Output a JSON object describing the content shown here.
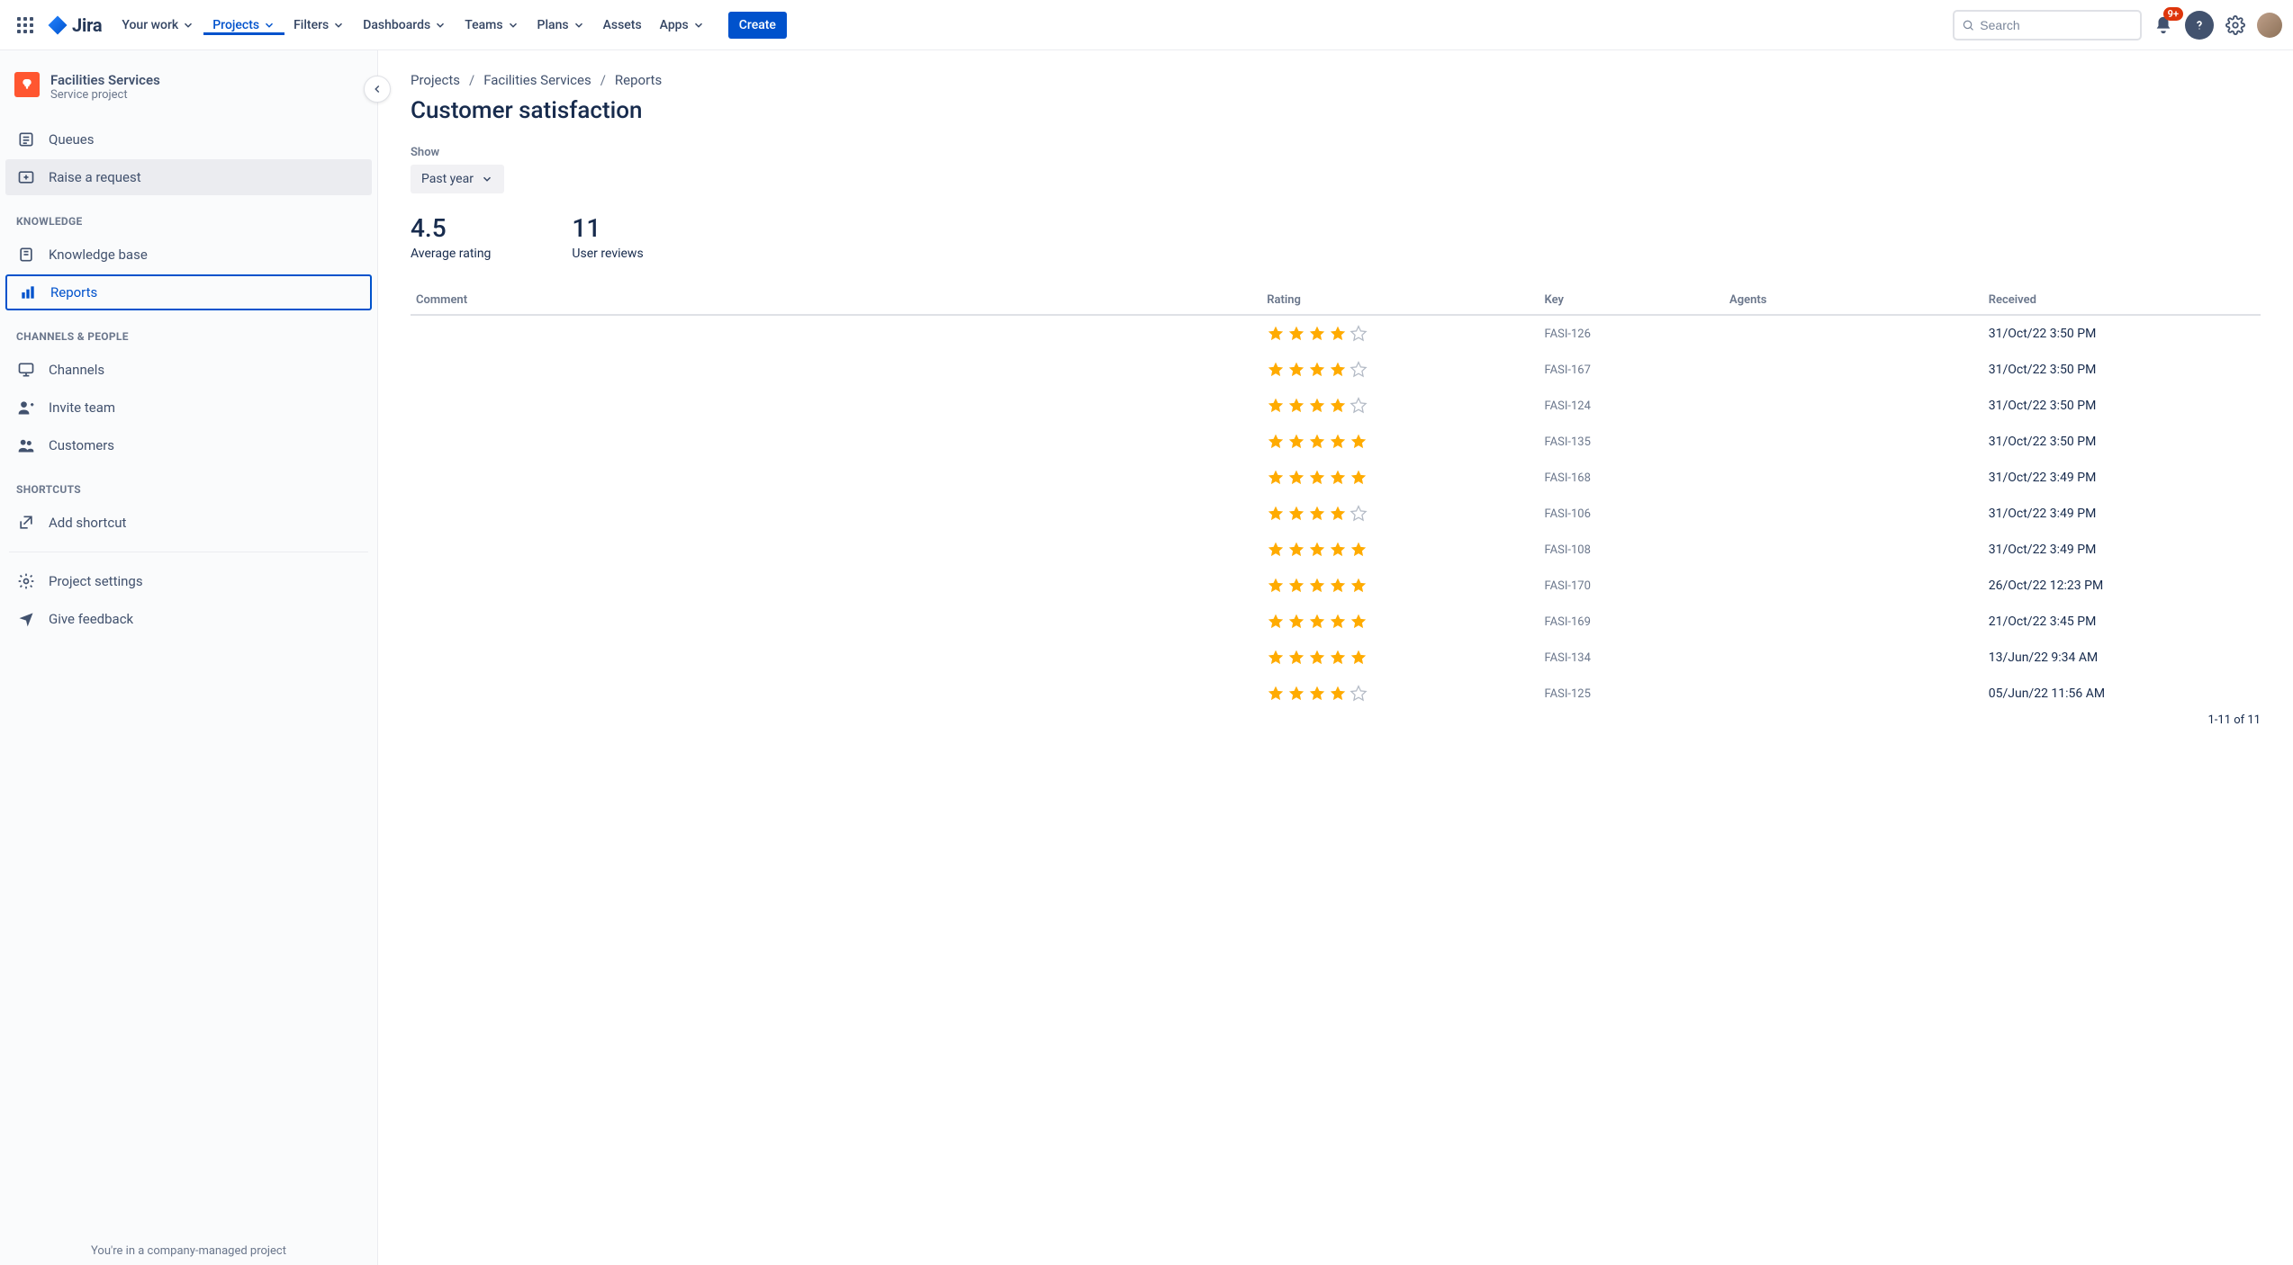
{
  "nav": {
    "logo_text": "Jira",
    "items": [
      {
        "label": "Your work",
        "dropdown": true
      },
      {
        "label": "Projects",
        "dropdown": true,
        "active": true
      },
      {
        "label": "Filters",
        "dropdown": true
      },
      {
        "label": "Dashboards",
        "dropdown": true
      },
      {
        "label": "Teams",
        "dropdown": true
      },
      {
        "label": "Plans",
        "dropdown": true
      },
      {
        "label": "Assets",
        "dropdown": false
      },
      {
        "label": "Apps",
        "dropdown": true
      }
    ],
    "create_label": "Create",
    "search_placeholder": "Search",
    "notification_badge": "9+"
  },
  "sidebar": {
    "project_name": "Facilities Services",
    "project_type": "Service project",
    "items_top": [
      {
        "label": "Queues",
        "icon": "queue-icon"
      },
      {
        "label": "Raise a request",
        "icon": "raise-request-icon",
        "selected": true
      }
    ],
    "section_knowledge": "KNOWLEDGE",
    "items_knowledge": [
      {
        "label": "Knowledge base",
        "icon": "book-icon"
      },
      {
        "label": "Reports",
        "icon": "reports-icon",
        "active": true
      }
    ],
    "section_channels": "CHANNELS & PEOPLE",
    "items_channels": [
      {
        "label": "Channels",
        "icon": "monitor-icon"
      },
      {
        "label": "Invite team",
        "icon": "invite-icon"
      },
      {
        "label": "Customers",
        "icon": "customers-icon"
      }
    ],
    "section_shortcuts": "SHORTCUTS",
    "items_shortcuts": [
      {
        "label": "Add shortcut",
        "icon": "add-shortcut-icon"
      }
    ],
    "items_footer": [
      {
        "label": "Project settings",
        "icon": "gear-icon"
      },
      {
        "label": "Give feedback",
        "icon": "feedback-icon"
      }
    ],
    "managed_note": "You're in a company-managed project"
  },
  "breadcrumbs": [
    "Projects",
    "Facilities Services",
    "Reports"
  ],
  "page": {
    "title": "Customer satisfaction",
    "show_label": "Show",
    "show_value": "Past year",
    "stats": [
      {
        "num": "4.5",
        "label": "Average rating"
      },
      {
        "num": "11",
        "label": "User reviews"
      }
    ]
  },
  "table": {
    "headers": {
      "comment": "Comment",
      "rating": "Rating",
      "key": "Key",
      "agents": "Agents",
      "received": "Received"
    },
    "rows": [
      {
        "comment": "",
        "rating": 4,
        "key": "FASI-126",
        "agents": "",
        "received": "31/Oct/22 3:50 PM"
      },
      {
        "comment": "",
        "rating": 4,
        "key": "FASI-167",
        "agents": "",
        "received": "31/Oct/22 3:50 PM"
      },
      {
        "comment": "",
        "rating": 4,
        "key": "FASI-124",
        "agents": "",
        "received": "31/Oct/22 3:50 PM"
      },
      {
        "comment": "",
        "rating": 5,
        "key": "FASI-135",
        "agents": "",
        "received": "31/Oct/22 3:50 PM"
      },
      {
        "comment": "",
        "rating": 5,
        "key": "FASI-168",
        "agents": "",
        "received": "31/Oct/22 3:49 PM"
      },
      {
        "comment": "",
        "rating": 4,
        "key": "FASI-106",
        "agents": "",
        "received": "31/Oct/22 3:49 PM"
      },
      {
        "comment": "",
        "rating": 5,
        "key": "FASI-108",
        "agents": "",
        "received": "31/Oct/22 3:49 PM"
      },
      {
        "comment": "",
        "rating": 5,
        "key": "FASI-170",
        "agents": "",
        "received": "26/Oct/22 12:23 PM"
      },
      {
        "comment": "",
        "rating": 5,
        "key": "FASI-169",
        "agents": "",
        "received": "21/Oct/22 3:45 PM"
      },
      {
        "comment": "",
        "rating": 5,
        "key": "FASI-134",
        "agents": "",
        "received": "13/Jun/22 9:34 AM"
      },
      {
        "comment": "",
        "rating": 4,
        "key": "FASI-125",
        "agents": "",
        "received": "05/Jun/22 11:56 AM"
      }
    ],
    "pager": "1-11 of 11"
  }
}
